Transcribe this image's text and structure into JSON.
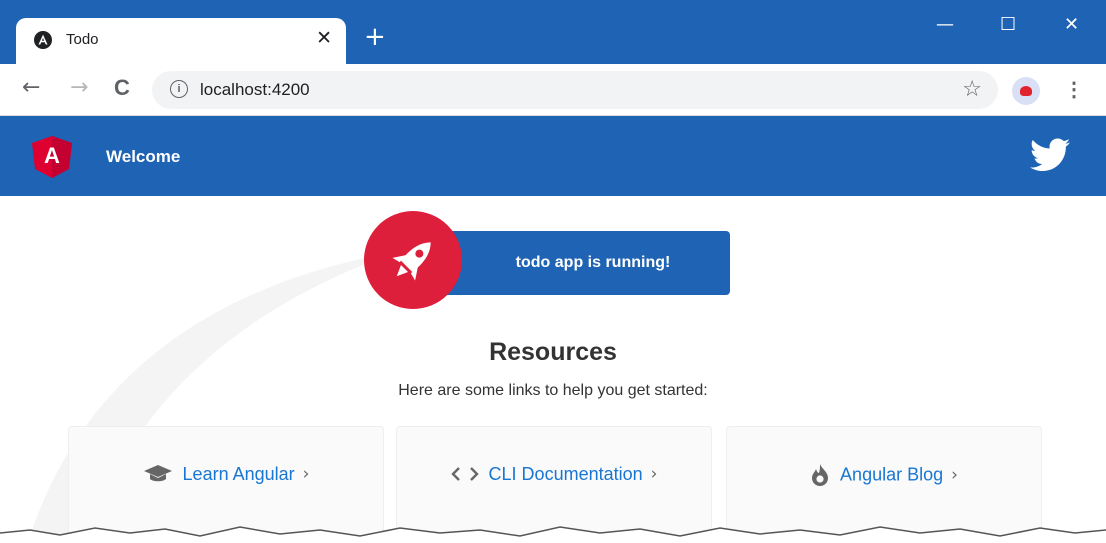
{
  "browser": {
    "tab": {
      "title": "Todo",
      "close_symbol": "✕",
      "new_tab_symbol": "+"
    },
    "window_controls": {
      "minimize": "—",
      "maximize": "☐",
      "close": "✕"
    },
    "toolbar": {
      "back_symbol": "←",
      "forward_symbol": "→",
      "reload_symbol": "C",
      "info_symbol": "i",
      "url": "localhost:4200",
      "bookmark_symbol": "☆",
      "menu_symbol": "⋮"
    },
    "colors": {
      "accent": "#1f63b5"
    }
  },
  "app": {
    "header": {
      "title": "Welcome",
      "logo_letter": "A"
    },
    "running_card": {
      "text": "todo app is running!"
    },
    "resources": {
      "title": "Resources",
      "subtitle": "Here are some links to help you get started:",
      "cards": [
        {
          "label": "Learn Angular",
          "icon": "graduation-cap-icon",
          "chevron": "›"
        },
        {
          "label": "CLI Documentation",
          "icon": "code-brackets-icon",
          "chevron": "›"
        },
        {
          "label": "Angular Blog",
          "icon": "flame-icon",
          "chevron": "›"
        }
      ]
    },
    "colors": {
      "primary": "#1f63b5",
      "angular_red": "#dd1f3b",
      "link": "#1976d2"
    }
  }
}
